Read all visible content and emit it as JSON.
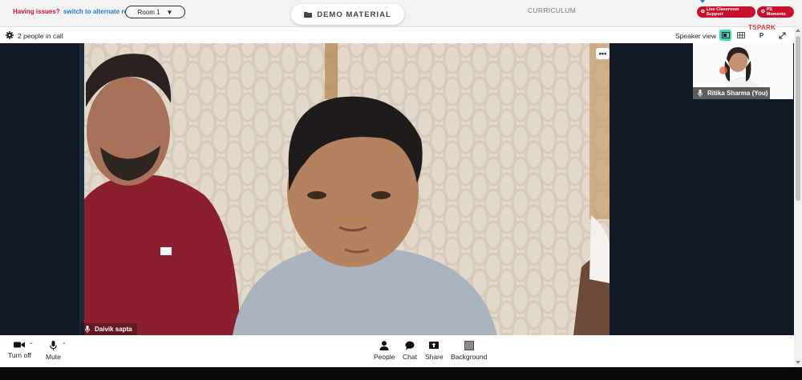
{
  "topbar": {
    "issues_question": "Having issues?",
    "issues_link": "switch to alternate room",
    "room_value": "Room 1",
    "demo_label": "DEMO MATERIAL",
    "curriculum_label": "CURRICULUM",
    "live_support_label": "Live Classroom Support",
    "moments_label": "PS Moments"
  },
  "callbar": {
    "people_count": "2 people in call",
    "view_label": "Speaker view",
    "p_label": "P"
  },
  "stage": {
    "main_participant": "Daivik sapta",
    "more_label": "•••",
    "self_participant": "Ritika Sharma (You)",
    "self_logo_text": "TSPARK"
  },
  "toolbar": {
    "turn_off": "Turn off",
    "mute": "Mute",
    "people": "People",
    "chat": "Chat",
    "share": "Share",
    "background": "Background"
  },
  "colors": {
    "brand_red": "#c8102e",
    "accent_green": "#3ed9a5",
    "stage_bg": "#111a24"
  }
}
